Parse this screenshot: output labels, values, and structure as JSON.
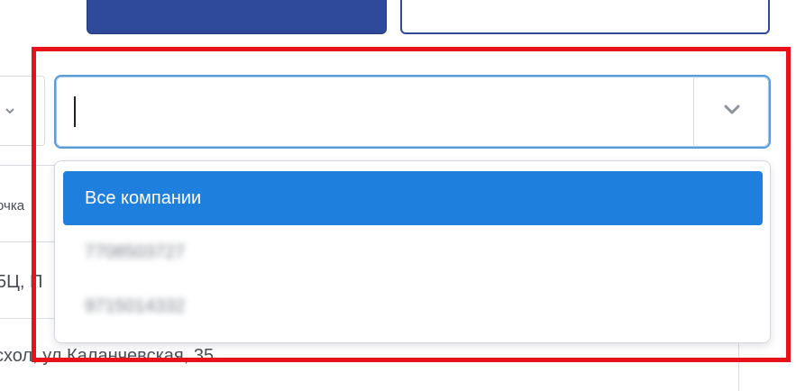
{
  "table_fragments": {
    "left_cell_1": "очка",
    "left_cell_2": "5Ц, П",
    "bottom_row_address": "схол, ул Каланчевская, 35"
  },
  "company_select": {
    "value": "",
    "placeholder": "",
    "options": [
      {
        "label": "Все компании",
        "selected": true
      },
      {
        "label": "7708503727",
        "selected": false
      },
      {
        "label": "9715014332",
        "selected": false
      }
    ]
  },
  "colors": {
    "highlight_frame": "#e8131a",
    "selected_option": "#1f7fdc",
    "primary_button": "#2f4a9a",
    "focus_border": "#5b9bd8"
  },
  "icons": {
    "dropdown_toggle": "chevron-down-icon"
  }
}
